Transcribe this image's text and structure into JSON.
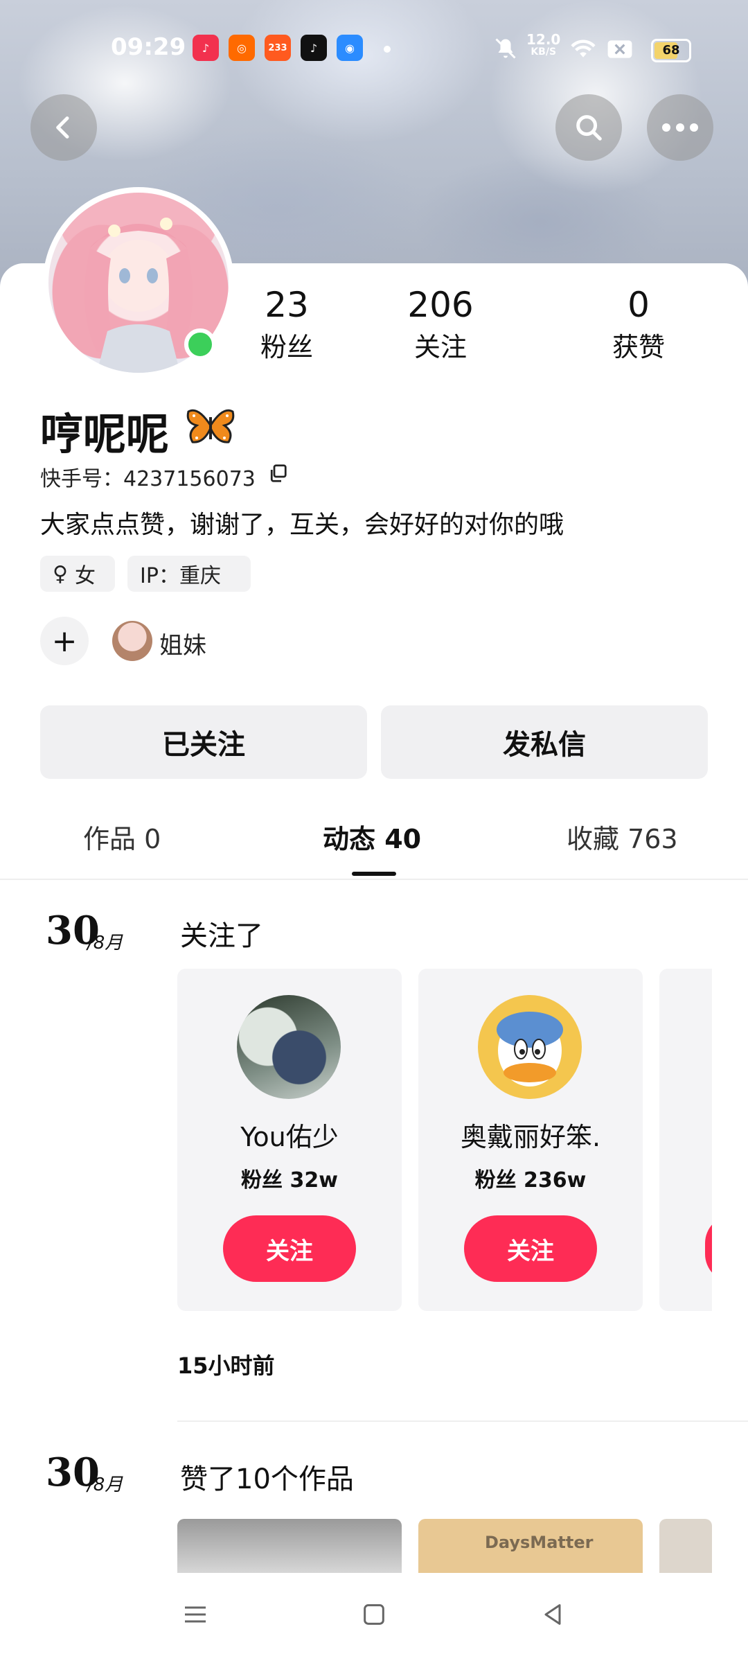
{
  "status_bar": {
    "time": "09:29",
    "apps": [
      {
        "name": "music-app-icon",
        "label": "♪",
        "color": "#f2314e"
      },
      {
        "name": "kuaishou-app-icon",
        "label": "◎",
        "color": "#ff6a00"
      },
      {
        "name": "233-app-icon",
        "label": "233",
        "color": "#ff5a1f"
      },
      {
        "name": "tiktok-app-icon",
        "label": "♪",
        "color": "#111111"
      },
      {
        "name": "browser-app-icon",
        "label": "◉",
        "color": "#2b8cff"
      }
    ],
    "network_speed": "12.0",
    "network_unit": "KB/S",
    "battery": "68",
    "battery_level": 0.68
  },
  "header": {
    "back_icon": "back-icon",
    "search_icon": "search-icon",
    "more_icon": "more-icon"
  },
  "profile": {
    "stats": [
      {
        "value": "23",
        "label": "粉丝"
      },
      {
        "value": "206",
        "label": "关注"
      },
      {
        "value": "0",
        "label": "获赞"
      }
    ],
    "username": "哼呢呢",
    "uid": "快手号：4237156073",
    "bio": "大家点点赞，谢谢了，互关，会好好的对你的哦",
    "tags": [
      {
        "icon": "♀",
        "text": "女"
      },
      {
        "icon": "",
        "text": "IP：重庆"
      }
    ],
    "relation_label": "姐妹"
  },
  "actions": {
    "followed": "已关注",
    "message": "发私信"
  },
  "tabs": [
    {
      "label": "作品 0"
    },
    {
      "label": "动态 40"
    },
    {
      "label": "收藏 763"
    }
  ],
  "feed": {
    "item1": {
      "day": "30",
      "month": "/8月",
      "title": "关注了",
      "cards": [
        {
          "name": "You佑少",
          "fans": "粉丝 32w",
          "button": "关注"
        },
        {
          "name": "奥戴丽好笨.",
          "fans": "粉丝 236w",
          "button": "关注"
        }
      ],
      "time_ago": "15小时前"
    },
    "item2": {
      "day": "30",
      "month": "/8月",
      "title": "赞了10个作品",
      "thumb_text": "DaysMatter"
    }
  }
}
